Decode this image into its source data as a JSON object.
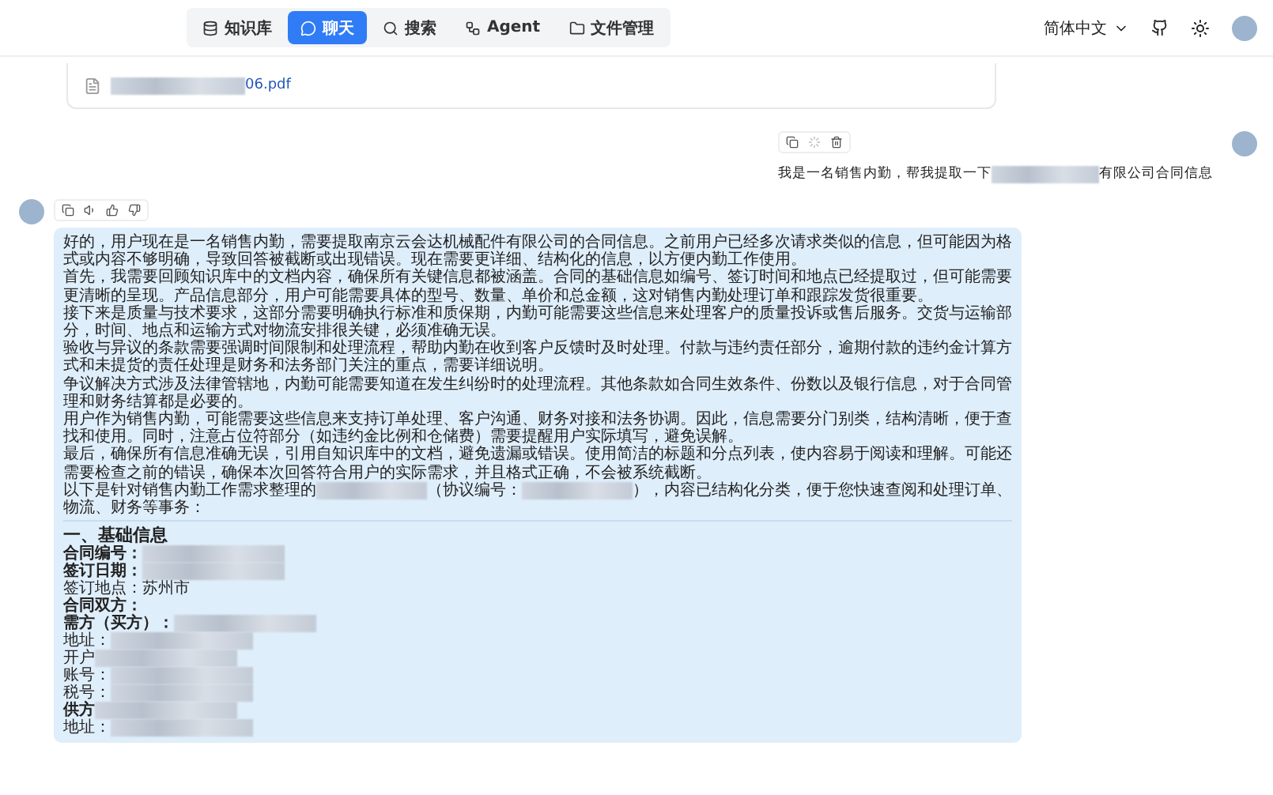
{
  "nav": {
    "tabs": [
      {
        "label": "知识库",
        "selected": false
      },
      {
        "label": "聊天",
        "selected": true
      },
      {
        "label": "搜索",
        "selected": false
      },
      {
        "label": "Agent",
        "selected": false
      },
      {
        "label": "文件管理",
        "selected": false
      }
    ],
    "language": "简体中文"
  },
  "file_card": {
    "name": [
      {
        "kind": "redacted"
      },
      {
        "kind": "text",
        "text": "06.pdf"
      }
    ]
  },
  "user_message": {
    "text": [
      {
        "kind": "text",
        "text": "我是一名销售内勤，帮我提取一下"
      },
      {
        "kind": "redacted"
      },
      {
        "kind": "text",
        "text": "有限公司合同信息"
      }
    ]
  },
  "bot_message": {
    "paragraphs": [
      [
        {
          "kind": "text",
          "text": "好的，用户现在是一名销售内勤，需要提取南京云会达机械配件有限公司的合同信息。之前用户已经多次请求类似的信息，但可能因为格式或内容不够明确，导致回答被截断或出现错误。现在需要更详细、结构化的信息，以方便内勤工作使用。"
        }
      ],
      [
        {
          "kind": "text",
          "text": "首先，我需要回顾知识库中的文档内容，确保所有关键信息都被涵盖。合同的基础信息如编号、签订时间和地点已经提取过，但可能需要更清晰的呈现。产品信息部分，用户可能需要具体的型号、数量、单价和总金额，这对销售内勤处理订单和跟踪发货很重要。"
        }
      ],
      [
        {
          "kind": "text",
          "text": "接下来是质量与技术要求，这部分需要明确执行标准和质保期，内勤可能需要这些信息来处理客户的质量投诉或售后服务。交货与运输部分，时间、地点和运输方式对物流安排很关键，必须准确无误。"
        }
      ],
      [
        {
          "kind": "text",
          "text": "验收与异议的条款需要强调时间限制和处理流程，帮助内勤在收到客户反馈时及时处理。付款与违约责任部分，逾期付款的违约金计算方式和未提货的责任处理是财务和法务部门关注的重点，需要详细说明。"
        }
      ],
      [
        {
          "kind": "text",
          "text": "争议解决方式涉及法律管辖地，内勤可能需要知道在发生纠纷时的处理流程。其他条款如合同生效条件、份数以及银行信息，对于合同管理和财务结算都是必要的。"
        }
      ],
      [
        {
          "kind": "text",
          "text": "用户作为销售内勤，可能需要这些信息来支持订单处理、客户沟通、财务对接和法务协调。因此，信息需要分门别类，结构清晰，便于查找和使用。同时，注意占位符部分（如违约金比例和仓储费）需要提醒用户实际填写，避免误解。"
        }
      ],
      [
        {
          "kind": "text",
          "text": "最后，确保所有信息准确无误，引用自知识库中的文档，避免遗漏或错误。使用简洁的标题和分点列表，使内容易于阅读和理解。可能还需要检查之前的错误，确保本次回答符合用户的实际需求，并且格式正确，不会被系统截断。"
        }
      ],
      [
        {
          "kind": "text",
          "text": "以下是针对销售内勤工作需求整理的"
        },
        {
          "kind": "redacted"
        },
        {
          "kind": "text",
          "text": "（协议编号："
        },
        {
          "kind": "redacted"
        },
        {
          "kind": "text",
          "text": "），内容已结构化分类，便于您快速查阅和处理订单、物流、财务等事务："
        }
      ]
    ],
    "heading": "一、基础信息",
    "fields": [
      {
        "label": "合同编号：",
        "bold": true,
        "value": [
          {
            "kind": "redacted"
          }
        ]
      },
      {
        "label": "签订日期：",
        "bold": true,
        "value": [
          {
            "kind": "redacted"
          }
        ]
      },
      {
        "label": "签订地点：",
        "bold": false,
        "value": [
          {
            "kind": "text",
            "text": "苏州市"
          }
        ]
      },
      {
        "label": "合同双方：",
        "bold": true
      },
      {
        "label": "需方（买方）：",
        "bold": true,
        "value": [
          {
            "kind": "redacted"
          }
        ]
      },
      {
        "label": "地址：",
        "bold": false,
        "value": [
          {
            "kind": "redacted"
          }
        ]
      },
      {
        "label": "开户",
        "bold": false,
        "value": [
          {
            "kind": "redacted"
          }
        ]
      },
      {
        "label": "账号：",
        "bold": false,
        "value": [
          {
            "kind": "redacted"
          }
        ]
      },
      {
        "label": "税号：",
        "bold": false,
        "value": [
          {
            "kind": "redacted"
          }
        ]
      },
      {
        "label": "供方",
        "bold": true,
        "value": [
          {
            "kind": "redacted"
          }
        ]
      },
      {
        "label": "地址：",
        "bold": false,
        "value": [
          {
            "kind": "redacted"
          }
        ]
      }
    ]
  }
}
